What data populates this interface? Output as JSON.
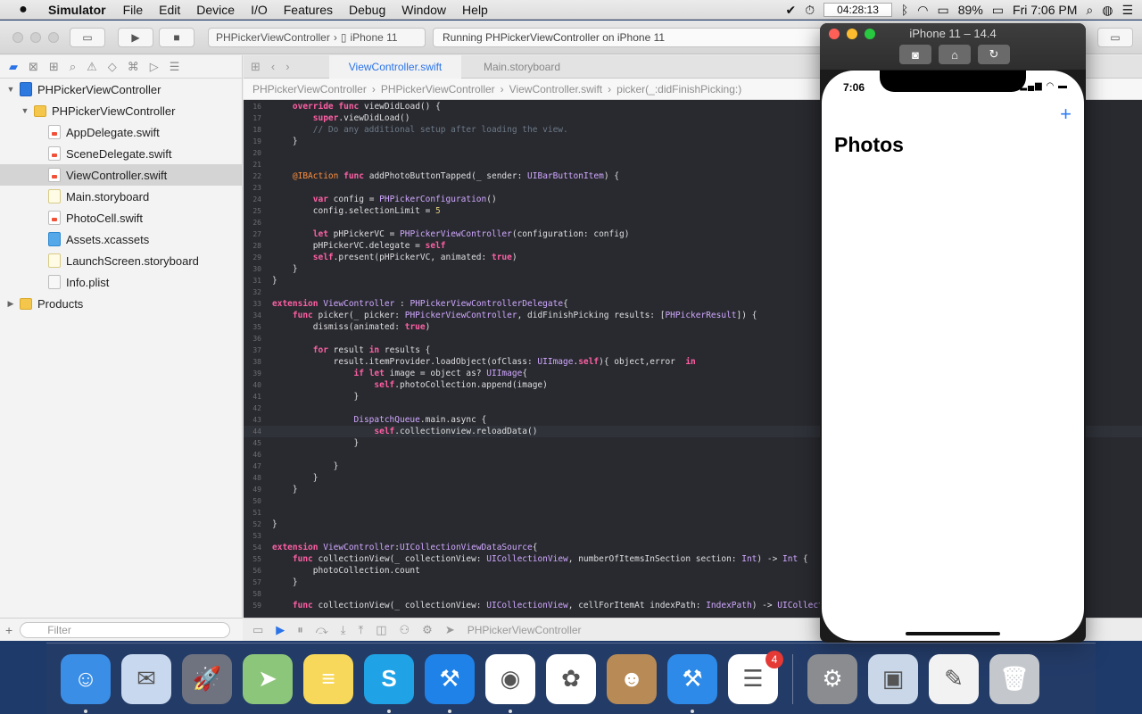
{
  "menubar": {
    "app_name": "Simulator",
    "items": [
      "File",
      "Edit",
      "Device",
      "I/O",
      "Features",
      "Debug",
      "Window",
      "Help"
    ],
    "clock_box": "04:28:13",
    "battery": "89%",
    "datetime": "Fri 7:06 PM"
  },
  "toolbar": {
    "scheme_project": "PHPickerViewController",
    "scheme_device": "iPhone 11",
    "status": "Running PHPickerViewController on iPhone 11"
  },
  "navigator": {
    "filter_placeholder": "Filter",
    "items": [
      {
        "label": "PHPickerViewController",
        "kind": "proj",
        "depth": 0,
        "expanded": true
      },
      {
        "label": "PHPickerViewController",
        "kind": "folder",
        "depth": 1,
        "expanded": true
      },
      {
        "label": "AppDelegate.swift",
        "kind": "swift",
        "depth": 2
      },
      {
        "label": "SceneDelegate.swift",
        "kind": "swift",
        "depth": 2
      },
      {
        "label": "ViewController.swift",
        "kind": "swift",
        "depth": 2,
        "selected": true
      },
      {
        "label": "Main.storyboard",
        "kind": "sb",
        "depth": 2
      },
      {
        "label": "PhotoCell.swift",
        "kind": "swift",
        "depth": 2
      },
      {
        "label": "Assets.xcassets",
        "kind": "assets",
        "depth": 2
      },
      {
        "label": "LaunchScreen.storyboard",
        "kind": "sb",
        "depth": 2
      },
      {
        "label": "Info.plist",
        "kind": "plist",
        "depth": 2
      },
      {
        "label": "Products",
        "kind": "folder",
        "depth": 0,
        "expanded": false
      }
    ]
  },
  "editor": {
    "tabs": [
      "ViewController.swift",
      "Main.storyboard"
    ],
    "jumpbar": [
      "PHPickerViewController",
      "PHPickerViewController",
      "ViewController.swift",
      "picker(_:didFinishPicking:)"
    ],
    "footer_label": "PHPickerViewController",
    "current_line": "44",
    "lines": [
      {
        "n": "16",
        "t": "    override func viewDidLoad() {"
      },
      {
        "n": "17",
        "t": "        super.viewDidLoad()"
      },
      {
        "n": "18",
        "t": "        // Do any additional setup after loading the view."
      },
      {
        "n": "19",
        "t": "    }"
      },
      {
        "n": "20",
        "t": ""
      },
      {
        "n": "21",
        "t": ""
      },
      {
        "n": "22",
        "t": "    @IBAction func addPhotoButtonTapped(_ sender: UIBarButtonItem) {"
      },
      {
        "n": "23",
        "t": ""
      },
      {
        "n": "24",
        "t": "        var config = PHPickerConfiguration()"
      },
      {
        "n": "25",
        "t": "        config.selectionLimit = 5"
      },
      {
        "n": "26",
        "t": ""
      },
      {
        "n": "27",
        "t": "        let pHPickerVC = PHPickerViewController(configuration: config)"
      },
      {
        "n": "28",
        "t": "        pHPickerVC.delegate = self"
      },
      {
        "n": "29",
        "t": "        self.present(pHPickerVC, animated: true)"
      },
      {
        "n": "30",
        "t": "    }"
      },
      {
        "n": "31",
        "t": "}"
      },
      {
        "n": "32",
        "t": ""
      },
      {
        "n": "33",
        "t": "extension ViewController : PHPickerViewControllerDelegate{"
      },
      {
        "n": "34",
        "t": "    func picker(_ picker: PHPickerViewController, didFinishPicking results: [PHPickerResult]) {"
      },
      {
        "n": "35",
        "t": "        dismiss(animated: true)"
      },
      {
        "n": "36",
        "t": ""
      },
      {
        "n": "37",
        "t": "        for result in results {"
      },
      {
        "n": "38",
        "t": "            result.itemProvider.loadObject(ofClass: UIImage.self){ object,error  in"
      },
      {
        "n": "39",
        "t": "                if let image = object as? UIImage{"
      },
      {
        "n": "40",
        "t": "                    self.photoCollection.append(image)"
      },
      {
        "n": "41",
        "t": "                }"
      },
      {
        "n": "42",
        "t": ""
      },
      {
        "n": "43",
        "t": "                DispatchQueue.main.async {"
      },
      {
        "n": "44",
        "t": "                    self.collectionview.reloadData()"
      },
      {
        "n": "45",
        "t": "                }"
      },
      {
        "n": "46",
        "t": ""
      },
      {
        "n": "47",
        "t": "            }"
      },
      {
        "n": "48",
        "t": "        }"
      },
      {
        "n": "49",
        "t": "    }"
      },
      {
        "n": "50",
        "t": ""
      },
      {
        "n": "51",
        "t": ""
      },
      {
        "n": "52",
        "t": "}"
      },
      {
        "n": "53",
        "t": ""
      },
      {
        "n": "54",
        "t": "extension ViewController:UICollectionViewDataSource{"
      },
      {
        "n": "55",
        "t": "    func collectionView(_ collectionView: UICollectionView, numberOfItemsInSection section: Int) -> Int {"
      },
      {
        "n": "56",
        "t": "        photoCollection.count"
      },
      {
        "n": "57",
        "t": "    }"
      },
      {
        "n": "58",
        "t": ""
      },
      {
        "n": "59",
        "t": "    func collectionView(_ collectionView: UICollectionView, cellForItemAt indexPath: IndexPath) -> UICollectionViewCell {"
      }
    ]
  },
  "simulator": {
    "title": "iPhone 11 – 14.4",
    "phone_time": "7:06",
    "nav_title": "Photos",
    "add_symbol": "+"
  },
  "dock": {
    "apps": [
      {
        "name": "finder-icon",
        "bg": "#3a8ee6",
        "glyph": "☺",
        "running": true
      },
      {
        "name": "mail-icon",
        "bg": "#c8d8ee",
        "glyph": "✉",
        "running": false
      },
      {
        "name": "launchpad-icon",
        "bg": "#6f7380",
        "glyph": "🚀",
        "running": false
      },
      {
        "name": "maps-icon",
        "bg": "#8cc67a",
        "glyph": "➤",
        "running": false
      },
      {
        "name": "notes-icon",
        "bg": "#f7d85a",
        "glyph": "≡",
        "running": false
      },
      {
        "name": "skype-icon",
        "bg": "#1fa3e6",
        "glyph": "S",
        "running": true
      },
      {
        "name": "xcode-icon",
        "bg": "#1f82e8",
        "glyph": "⚒",
        "running": true
      },
      {
        "name": "chrome-icon",
        "bg": "#ffffff",
        "glyph": "◉",
        "running": true
      },
      {
        "name": "photos-icon",
        "bg": "#ffffff",
        "glyph": "✿",
        "running": false
      },
      {
        "name": "contacts-icon",
        "bg": "#b88a55",
        "glyph": "☻",
        "running": false
      },
      {
        "name": "simulator-icon",
        "bg": "#2d8ae8",
        "glyph": "⚒",
        "running": true
      },
      {
        "name": "reminders-icon",
        "bg": "#ffffff",
        "glyph": "☰",
        "running": false,
        "badge": "4"
      }
    ],
    "right_apps": [
      {
        "name": "system-preferences-icon",
        "bg": "#8a8c90",
        "glyph": "⚙"
      },
      {
        "name": "preview-icon",
        "bg": "#c9d7e8",
        "glyph": "▣"
      },
      {
        "name": "textedit-icon",
        "bg": "#f2f2f2",
        "glyph": "✎"
      },
      {
        "name": "trash-icon",
        "bg": "#c4c8cc",
        "glyph": "🗑"
      }
    ]
  }
}
